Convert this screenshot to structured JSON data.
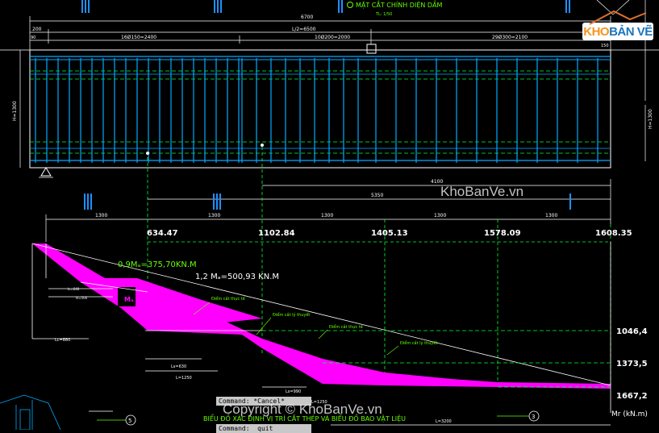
{
  "colors": {
    "background": "#000000",
    "beam_lines": "#00aaff",
    "dim_lines": "#ffffff",
    "green_text": "#66ff00",
    "dashed_green": "#00ff33",
    "moment_fill": "#ff00ff",
    "command_bg": "#c8c8c8"
  },
  "titles": {
    "section_title": "MẶT CẮT CHÍNH DIỆN DẦM",
    "section_scale": "TL: 1/50",
    "diagram_title": "BIỂU ĐỒ XÁC ĐỊNH VỊ TRÍ CẮT THÉP VÀ BIỂU ĐỒ BAO VẬT LIỆU",
    "axis_unit": "Mr (kN.m)"
  },
  "dimensions": {
    "total": "6700",
    "half": "L/2=6500",
    "left_200": "200",
    "left_90": "90",
    "seg1": "16Ø150=2400",
    "seg2": "10Ø200=2000",
    "seg3": "29Ø300=2100",
    "right_150": "150",
    "height_left": "H=1300",
    "height_right": "H=1300",
    "lower_4100": "4100",
    "lower_5350": "5350",
    "bottom_dims": [
      "1300",
      "1300",
      "1300",
      "1300",
      "1300"
    ],
    "lb1": "lc=640",
    "lb2": "ls=500",
    "lb3": "Lc=880",
    "lb4": "Ls=630",
    "lb5": "L=1250",
    "lb6": "Ls=990",
    "lb7": "L=1250",
    "lb8": "L=3200"
  },
  "section_markers": [
    "III",
    "III",
    "III",
    "III",
    "III"
  ],
  "moment_values": [
    "634.47",
    "1102.84",
    "1405.13",
    "1578.09",
    "1608.35"
  ],
  "annotations": {
    "m1": "0,9Mₐ=375,70KN.M",
    "m2": "1,2 Mₐ=500,93 KN.M",
    "ma": "Mₐ",
    "cut1": "Điểm cắt thực tế",
    "cut2": "Điểm cắt lý thuyết",
    "cut3": "Điểm cắt thực tế",
    "cut4": "Điểm cắt lý thuyết"
  },
  "right_values": [
    "1046,4",
    "1373,5",
    "1667,2"
  ],
  "circle_labels": [
    "5",
    "3"
  ],
  "command": {
    "line1": "Command: *Cancel*",
    "line2": "Command:  quit"
  },
  "logo": {
    "part1": "KHO",
    "part2": "BẢN VẼ"
  },
  "watermark": {
    "text1": "KhoBanVe.vn",
    "text2": "Copyright © KhoBanVe.vn"
  }
}
